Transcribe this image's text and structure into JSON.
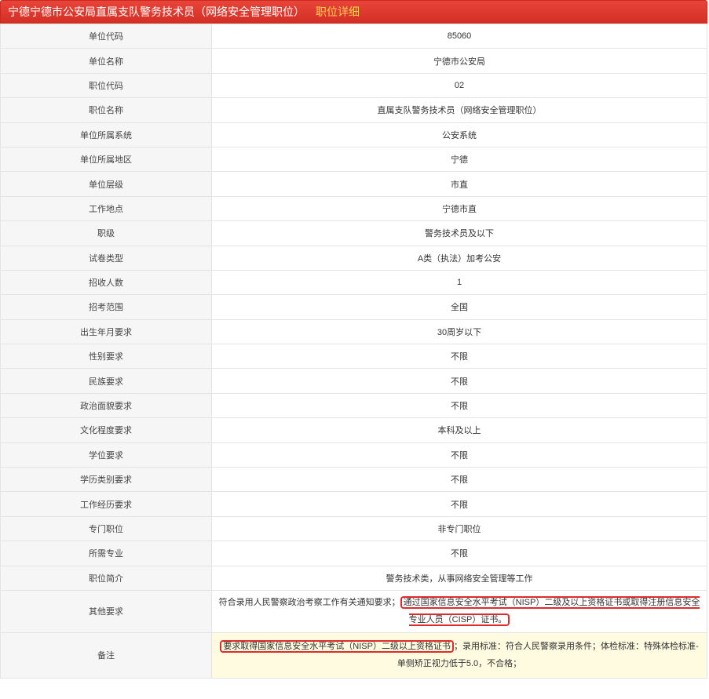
{
  "header": {
    "title": "宁德宁德市公安局直属支队警务技术员（网络安全管理职位）",
    "subtitle": "职位详细"
  },
  "rows": [
    {
      "label": "单位代码",
      "value": "85060"
    },
    {
      "label": "单位名称",
      "value": "宁德市公安局"
    },
    {
      "label": "职位代码",
      "value": "02"
    },
    {
      "label": "职位名称",
      "value": "直属支队警务技术员（网络安全管理职位）"
    },
    {
      "label": "单位所属系统",
      "value": "公安系统"
    },
    {
      "label": "单位所属地区",
      "value": "宁德"
    },
    {
      "label": "单位层级",
      "value": "市直"
    },
    {
      "label": "工作地点",
      "value": "宁德市直"
    },
    {
      "label": "职级",
      "value": "警务技术员及以下"
    },
    {
      "label": "试卷类型",
      "value": "A类（执法）加考公安"
    },
    {
      "label": "招收人数",
      "value": "1"
    },
    {
      "label": "招考范围",
      "value": "全国"
    },
    {
      "label": "出生年月要求",
      "value": "30周岁以下"
    },
    {
      "label": "性别要求",
      "value": "不限"
    },
    {
      "label": "民族要求",
      "value": "不限"
    },
    {
      "label": "政治面貌要求",
      "value": "不限"
    },
    {
      "label": "文化程度要求",
      "value": "本科及以上"
    },
    {
      "label": "学位要求",
      "value": "不限"
    },
    {
      "label": "学历类别要求",
      "value": "不限"
    },
    {
      "label": "工作经历要求",
      "value": "不限"
    },
    {
      "label": "专门职位",
      "value": "非专门职位"
    },
    {
      "label": "所需专业",
      "value": "不限"
    },
    {
      "label": "职位简介",
      "value": "警务技术类，从事网络安全管理等工作"
    }
  ],
  "other": {
    "label": "其他要求",
    "prefix": "符合录用人民警察政治考察工作有关通知要求；",
    "highlight": "通过国家信息安全水平考试（NISP）二级及以上资格证书或取得注册信息安全专业人员（CISP）证书。"
  },
  "note": {
    "label": "备注",
    "highlight": "要求取得国家信息安全水平考试（NISP）二级以上资格证书",
    "suffix": "；录用标准：符合人民警察录用条件；体检标准：特殊体检标准-单侧矫正视力低于5.0，不合格；"
  }
}
